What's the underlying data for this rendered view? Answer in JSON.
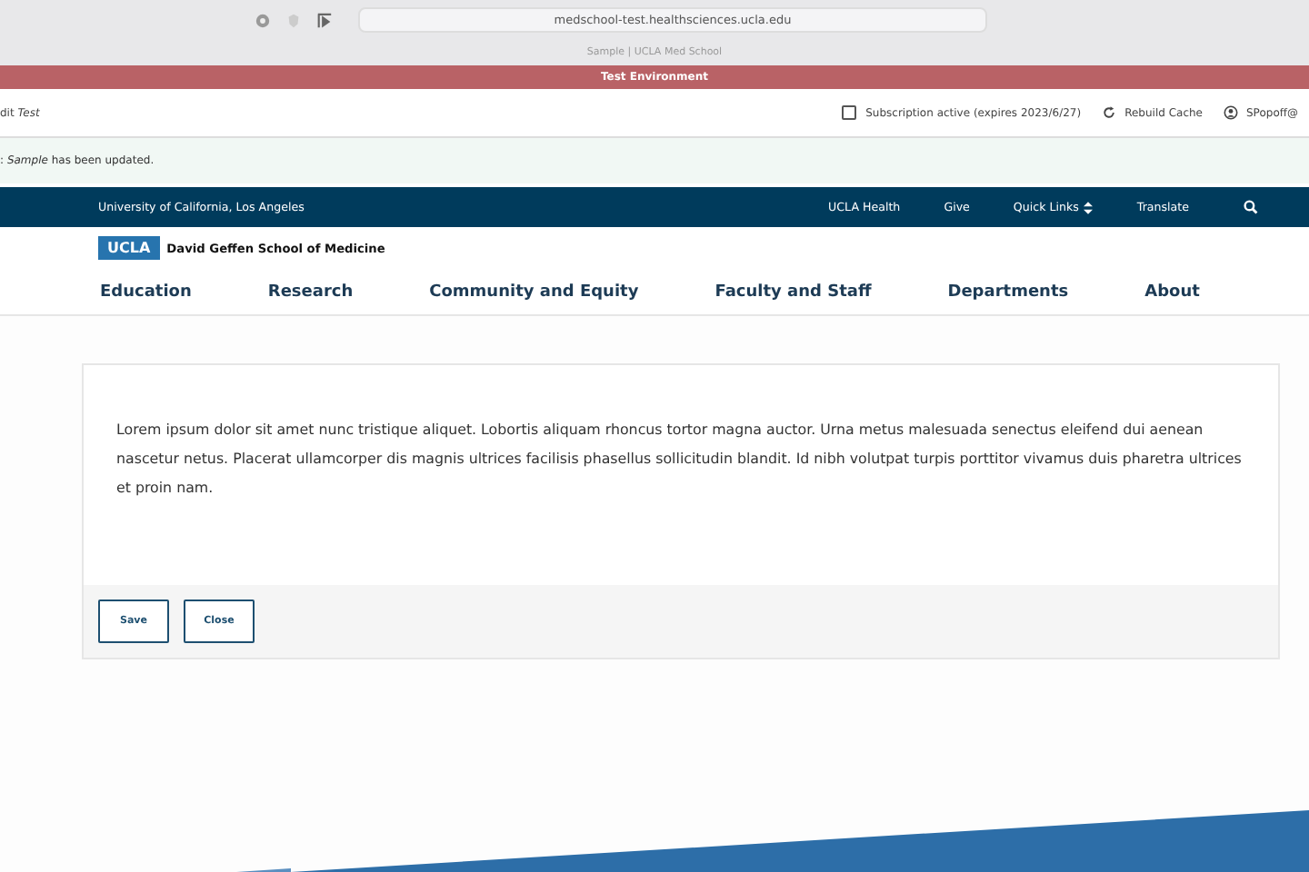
{
  "browser": {
    "url": "medschool-test.healthsciences.ucla.edu",
    "tab_title": "Sample | UCLA Med School"
  },
  "environment_banner": "Test Environment",
  "admin_bar": {
    "edit_label": "dit *Test*",
    "subscription": {
      "label": "Subscription active (expires 2023/6/27)",
      "checked": false
    },
    "rebuild_cache": "Rebuild Cache",
    "user": "SPopoff@"
  },
  "status_message": ": *Sample* has been updated.",
  "utility_bar": {
    "university": "University of California, Los Angeles",
    "links": [
      {
        "label": "UCLA Health",
        "kind": "link"
      },
      {
        "label": "Give",
        "kind": "link"
      },
      {
        "label": "Quick Links",
        "kind": "dropdown"
      },
      {
        "label": "Translate",
        "kind": "link"
      }
    ]
  },
  "logo": {
    "badge": "UCLA",
    "school": "David Geffen School of Medicine"
  },
  "main_nav": [
    "Education",
    "Research",
    "Community and Equity",
    "Faculty and Staff",
    "Departments",
    "About"
  ],
  "card": {
    "body": "Lorem ipsum dolor sit amet nunc tristique aliquet. Lobortis aliquam rhoncus tortor magna auctor. Urna metus malesuada senectus eleifend dui aenean nascetur netus. Placerat ullamcorper dis magnis ultrices facilisis phasellus sollicitudin blandit. Id nibh volutpat turpis porttitor vivamus duis pharetra ultrices et proin nam.",
    "buttons": [
      "Save",
      "Close"
    ]
  }
}
